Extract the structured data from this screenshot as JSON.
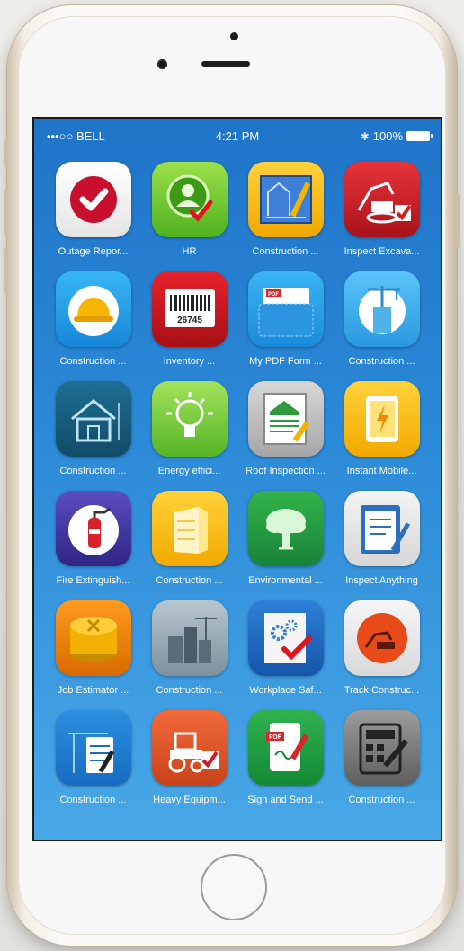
{
  "status_bar": {
    "carrier": "•••○○ BELL",
    "time": "4:21 PM",
    "battery": "100%"
  },
  "apps": [
    {
      "label": "Outage Repor...",
      "icon": "checkmark-badge-icon"
    },
    {
      "label": "HR",
      "icon": "person-check-icon"
    },
    {
      "label": "Construction ...",
      "icon": "blueprint-icon"
    },
    {
      "label": "Inspect Excava...",
      "icon": "excavator-check-icon"
    },
    {
      "label": "Construction ...",
      "icon": "hard-hat-icon"
    },
    {
      "label": "Inventory ...",
      "icon": "barcode-icon",
      "barcode": "26745"
    },
    {
      "label": "My PDF Form ...",
      "icon": "pdf-pocket-icon",
      "badge": "PDF"
    },
    {
      "label": "Construction ...",
      "icon": "crane-building-icon"
    },
    {
      "label": "Construction ...",
      "icon": "house-plan-icon"
    },
    {
      "label": "Energy effici...",
      "icon": "light-bulb-icon"
    },
    {
      "label": "Roof Inspection ...",
      "icon": "roof-document-icon"
    },
    {
      "label": "Instant Mobile...",
      "icon": "tablet-bolt-icon"
    },
    {
      "label": "Fire Extinguish...",
      "icon": "fire-extinguisher-icon"
    },
    {
      "label": "Construction ...",
      "icon": "building-icon"
    },
    {
      "label": "Environmental ...",
      "icon": "tree-icon"
    },
    {
      "label": "Inspect Anything",
      "icon": "clipboard-pen-icon"
    },
    {
      "label": "Job Estimator ...",
      "icon": "coin-stack-icon"
    },
    {
      "label": "Construction ...",
      "icon": "city-cranes-icon"
    },
    {
      "label": "Workplace Saf...",
      "icon": "gears-check-icon"
    },
    {
      "label": "Track Construc...",
      "icon": "excavator-circle-icon"
    },
    {
      "label": "Construction ...",
      "icon": "clipboard-crane-icon"
    },
    {
      "label": "Heavy Equipm...",
      "icon": "tractor-check-icon"
    },
    {
      "label": "Sign and Send ...",
      "icon": "pdf-sign-icon",
      "badge": "PDF"
    },
    {
      "label": "Construction ...",
      "icon": "calculator-hammer-icon"
    }
  ]
}
